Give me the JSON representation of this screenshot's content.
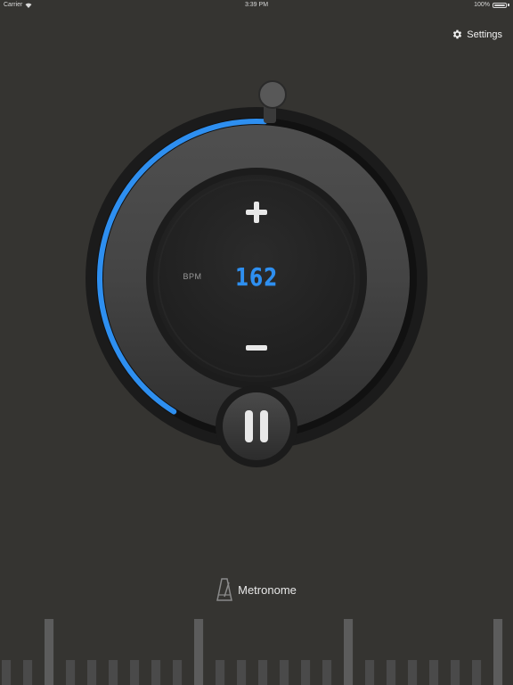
{
  "status_bar": {
    "carrier": "Carrier",
    "time": "3:39 PM",
    "battery": "100%"
  },
  "header": {
    "settings_label": "Settings"
  },
  "metronome": {
    "bpm_label": "BPM",
    "bpm_value": "162",
    "tempo_fraction": 0.42
  },
  "footer": {
    "title": "Metronome"
  },
  "beat_bars": {
    "count": 24,
    "accent_every": 7
  },
  "colors": {
    "background": "#353431",
    "accent": "#2e8ff0",
    "bpm_text": "#2e8ff0",
    "bar_dim": "#4a4a4a",
    "bar_accent": "#5c5c5c"
  },
  "icons": {
    "settings": "gear-icon",
    "plus": "plus-icon",
    "minus": "minus-icon",
    "pause": "pause-icon",
    "metronome": "metronome-icon",
    "wifi": "wifi-icon",
    "battery": "battery-icon"
  }
}
